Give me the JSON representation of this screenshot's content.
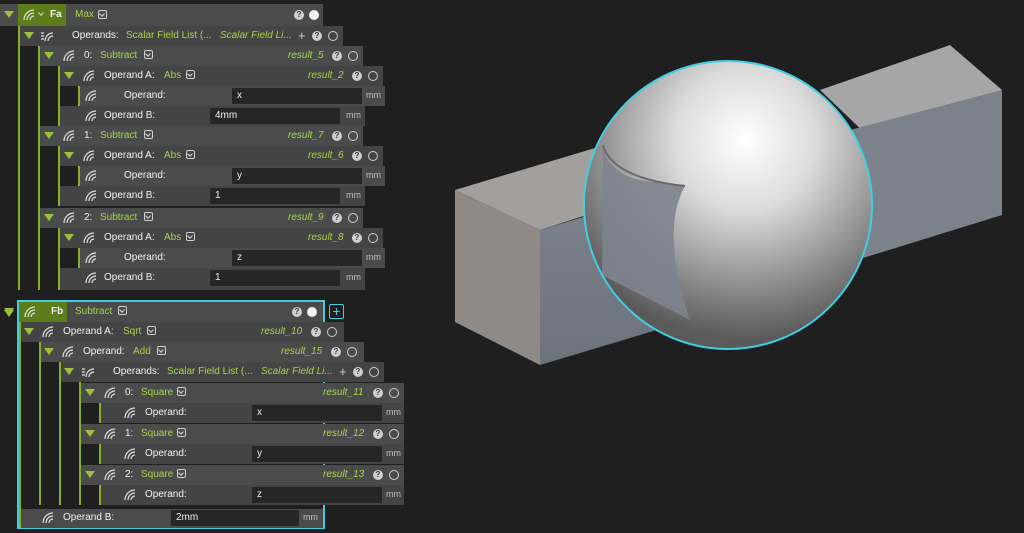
{
  "node_fa": {
    "name": "Fa",
    "op": "Max",
    "operands_label": "Operands:",
    "operands_type": "Scalar Field List (...",
    "operands_type2": "Scalar Field Li...",
    "items": [
      {
        "index": "0:",
        "op": "Subtract",
        "result": "result_5",
        "operand_a": {
          "label": "Operand A:",
          "op": "Abs",
          "result": "result_2",
          "operand_label": "Operand:",
          "operand_value": "x",
          "unit": "mm"
        },
        "operand_b": {
          "label": "Operand B:",
          "value": "4mm",
          "unit": "mm"
        }
      },
      {
        "index": "1:",
        "op": "Subtract",
        "result": "result_7",
        "operand_a": {
          "label": "Operand A:",
          "op": "Abs",
          "result": "result_6",
          "operand_label": "Operand:",
          "operand_value": "y",
          "unit": "mm"
        },
        "operand_b": {
          "label": "Operand B:",
          "value": "1",
          "unit": "mm"
        }
      },
      {
        "index": "2:",
        "op": "Subtract",
        "result": "result_9",
        "operand_a": {
          "label": "Operand A:",
          "op": "Abs",
          "result": "result_8",
          "operand_label": "Operand:",
          "operand_value": "z",
          "unit": "mm"
        },
        "operand_b": {
          "label": "Operand B:",
          "value": "1",
          "unit": "mm"
        }
      }
    ]
  },
  "node_fb": {
    "name": "Fb",
    "op": "Subtract",
    "add_button": "+",
    "operand_a": {
      "label": "Operand A:",
      "op": "Sqrt",
      "result": "result_10",
      "operand": {
        "label": "Operand:",
        "op": "Add",
        "result": "result_15",
        "operands_label": "Operands:",
        "operands_type": "Scalar Field List (...",
        "operands_type2": "Scalar Field Li...",
        "items": [
          {
            "index": "0:",
            "op": "Square",
            "result": "result_11",
            "operand_label": "Operand:",
            "value": "x",
            "unit": "mm"
          },
          {
            "index": "1:",
            "op": "Square",
            "result": "result_12",
            "operand_label": "Operand:",
            "value": "y",
            "unit": "mm"
          },
          {
            "index": "2:",
            "op": "Square",
            "result": "result_13",
            "operand_label": "Operand:",
            "value": "z",
            "unit": "mm"
          }
        ]
      }
    },
    "operand_b": {
      "label": "Operand B:",
      "value": "2mm",
      "unit": "mm"
    }
  },
  "glyphs": {
    "help": "?",
    "plus": "+"
  },
  "icons": [
    "field-icon",
    "list-icon",
    "help-icon",
    "visibility-ring-icon",
    "visibility-dot-icon",
    "expand-triangle-icon",
    "dropdown-chevron-icon"
  ],
  "colors": {
    "accent_green": "#a6d44a",
    "selection_cyan": "#42cde0",
    "panel": "#4b4b4b",
    "field": "#262626"
  },
  "viewport": {
    "scene": "box-with-sphere-cut",
    "selection": "sphere"
  }
}
